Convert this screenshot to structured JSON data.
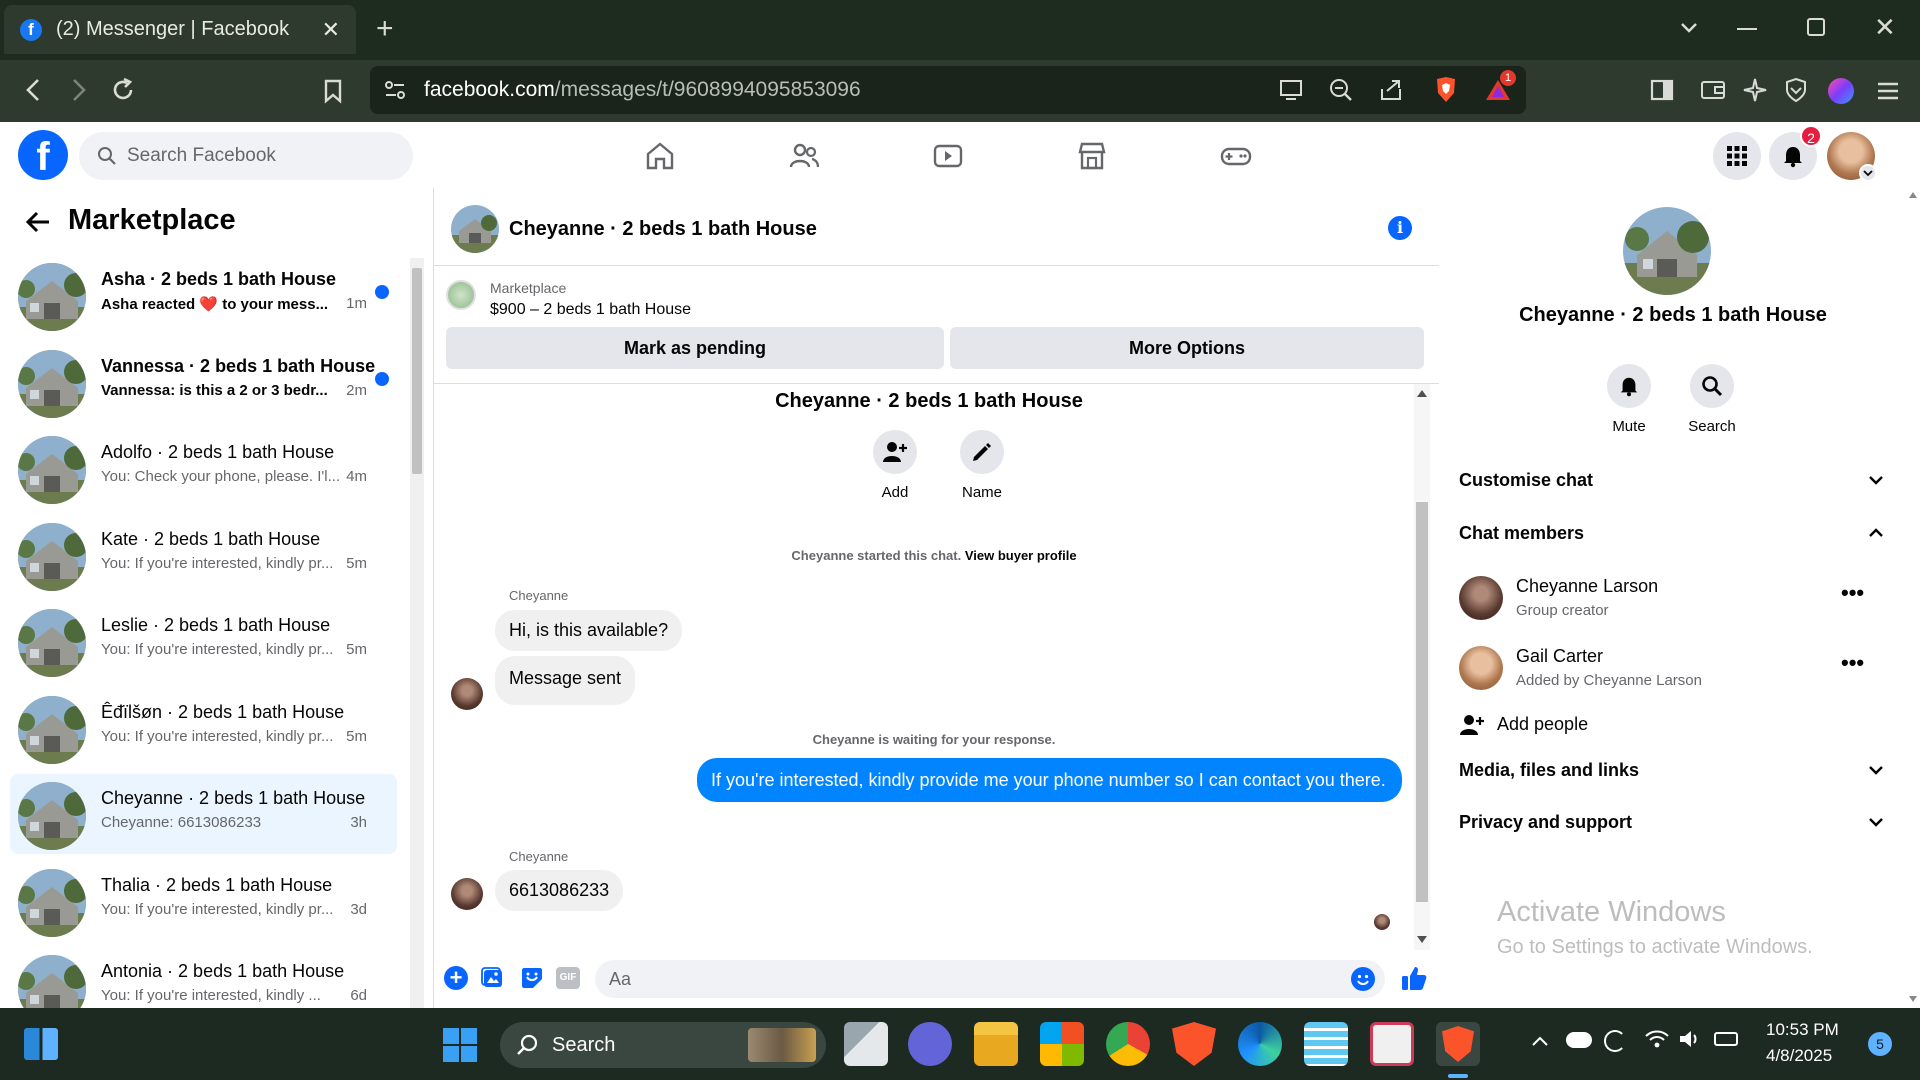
{
  "browser": {
    "tab_title": "(2) Messenger | Facebook",
    "url_domain": "facebook.com",
    "url_path": "/messages/t/9608994095853096",
    "alerts_badge": "1"
  },
  "fb": {
    "search_placeholder": "Search Facebook",
    "notifications_badge": "2"
  },
  "left": {
    "title": "Marketplace",
    "conversations": [
      {
        "name": "Asha · 2 beds 1 bath House",
        "snippet": "Asha reacted ❤️ to your mess...",
        "time": "1m",
        "unread": true
      },
      {
        "name": "Vannessa · 2 beds 1 bath House",
        "snippet": "Vannessa: is this a 2 or 3 bedr...",
        "time": "2m",
        "unread": true
      },
      {
        "name": "Adolfo · 2 beds 1 bath House",
        "snippet": "You: Check your phone, please. I'l...",
        "time": "4m",
        "unread": false
      },
      {
        "name": "Kate · 2 beds 1 bath House",
        "snippet": "You: If you're interested, kindly pr...",
        "time": "5m",
        "unread": false
      },
      {
        "name": "Leslie · 2 beds 1 bath House",
        "snippet": "You: If you're interested, kindly pr...",
        "time": "5m",
        "unread": false
      },
      {
        "name": "Êđïlšøn · 2 beds 1 bath House",
        "snippet": "You: If you're interested, kindly pr...",
        "time": "5m",
        "unread": false
      },
      {
        "name": "Cheyanne · 2 beds 1 bath House",
        "snippet": "Cheyanne: 6613086233",
        "time": "3h",
        "unread": false,
        "selected": true
      },
      {
        "name": "Thalia · 2 beds 1 bath House",
        "snippet": "You: If you're interested, kindly pr...",
        "time": "3d",
        "unread": false
      },
      {
        "name": "Antonia · 2 beds 1 bath House",
        "snippet": "You: If you're interested, kindly ...",
        "time": "6d",
        "unread": false
      }
    ]
  },
  "chat": {
    "title": "Cheyanne · 2 beds 1 bath House",
    "listing_label": "Marketplace",
    "listing_detail": "$900 – 2 beds 1 bath House",
    "mark_pending": "Mark as pending",
    "more_options": "More Options",
    "group_title": "Cheyanne · 2 beds 1 bath House",
    "add_label": "Add",
    "name_label": "Name",
    "started_text": "Cheyanne started this chat.",
    "view_buyer": "View buyer profile",
    "sender1": "Cheyanne",
    "msg1": "Hi, is this available?",
    "msg2": "Message sent",
    "waiting": "Cheyanne is waiting for your response.",
    "my_msg": "If you're interested, kindly provide me your phone number so I can contact you there.",
    "sender2": "Cheyanne",
    "msg3": "6613086233",
    "input_placeholder": "Aa"
  },
  "right": {
    "title": "Cheyanne · 2 beds 1 bath House",
    "mute": "Mute",
    "search": "Search",
    "customise": "Customise chat",
    "members": "Chat members",
    "member1_name": "Cheyanne Larson",
    "member1_role": "Group creator",
    "member2_name": "Gail Carter",
    "member2_role": "Added by Cheyanne Larson",
    "add_people": "Add people",
    "media": "Media, files and links",
    "privacy": "Privacy and support",
    "activate_title": "Activate Windows",
    "activate_sub": "Go to Settings to activate Windows."
  },
  "taskbar": {
    "search": "Search",
    "time": "10:53 PM",
    "date": "4/8/2025",
    "notif_count": "5"
  },
  "colors": {
    "fb_blue": "#0866ff",
    "messenger_blue": "#0084ff",
    "brave_orange": "#fb542b"
  }
}
